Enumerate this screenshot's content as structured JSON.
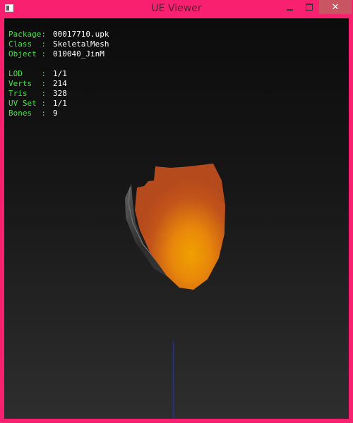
{
  "window": {
    "title": "UE Viewer",
    "app_icon": "window-app-icon",
    "controls": {
      "minimize": "minimize-icon",
      "maximize": "maximize-icon",
      "close": "✕"
    },
    "colors": {
      "frame": "#f9206f",
      "close": "#c95563",
      "label": "#3fe23f",
      "value": "#ffffff"
    }
  },
  "info": {
    "package_label": "Package:",
    "package_value": "00017710.upk",
    "class_label": "Class  :",
    "class_value": "SkeletalMesh",
    "object_label": "Object :",
    "object_value": "010040_JinM",
    "lod_label": "LOD    :",
    "lod_value": "1/1",
    "verts_label": "Verts  :",
    "verts_value": "214",
    "tris_label": "Tris   :",
    "tris_value": "328",
    "uvset_label": "UV Set :",
    "uvset_value": "1/1",
    "bones_label": "Bones  :",
    "bones_value": "9"
  }
}
